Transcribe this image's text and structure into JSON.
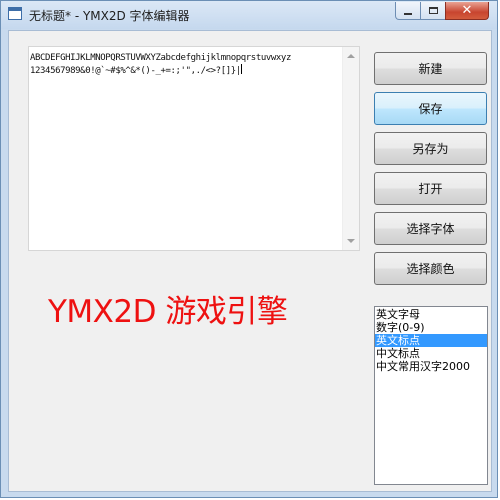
{
  "window": {
    "title": "无标题* - YMX2D 字体编辑器",
    "close_glyph": "✕"
  },
  "editor": {
    "line1": "ABCDEFGHIJKLMNOPQRSTUVWXYZabcdefghijklmnopqrstuvwxyz",
    "line2": "1234567989&0!@`~#$%^&*()-_+=:;'\",./<>?[]}|"
  },
  "buttons": {
    "new": "新建",
    "save": "保存",
    "save_as": "另存为",
    "open": "打开",
    "choose_font": "选择字体",
    "choose_color": "选择颜色"
  },
  "brand_text": "YMX2D 游戏引擎",
  "char_sets": {
    "items": [
      "英文字母",
      "数字(0-9)",
      "英文标点",
      "中文标点",
      "中文常用汉字2000"
    ],
    "selected": "英文标点"
  },
  "colors": {
    "accent": "#3399ff",
    "brand_red": "#ee1111"
  }
}
